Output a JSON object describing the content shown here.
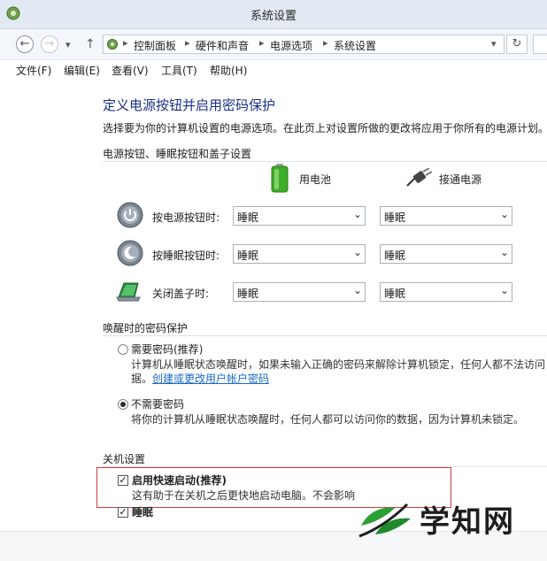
{
  "window": {
    "title": "系统设置"
  },
  "nav": {
    "breadcrumbs": [
      "控制面板",
      "硬件和声音",
      "电源选项",
      "系统设置"
    ]
  },
  "menu": [
    "文件(F)",
    "编辑(E)",
    "查看(V)",
    "工具(T)",
    "帮助(H)"
  ],
  "main": {
    "title": "定义电源按钮并启用密码保护",
    "description": "选择要为你的计算机设置的电源选项。在此页上对设置所做的更改将应用于你所有的电源计划。",
    "power_section": {
      "heading": "电源按钮、睡眠按钮和盖子设置",
      "columns": [
        "用电池",
        "接通电源"
      ],
      "rows": [
        {
          "label": "按电源按钮时:",
          "battery": "睡眠",
          "plugged": "睡眠",
          "icon": "power-button-icon"
        },
        {
          "label": "按睡眠按钮时:",
          "battery": "睡眠",
          "plugged": "睡眠",
          "icon": "sleep-button-icon"
        },
        {
          "label": "关闭盖子时:",
          "battery": "睡眠",
          "plugged": "睡眠",
          "icon": "laptop-lid-icon"
        }
      ]
    },
    "password_section": {
      "heading": "唤醒时的密码保护",
      "options": [
        {
          "label": "需要密码(推荐)",
          "desc_line1": "计算机从睡眠状态唤醒时，如果未输入正确的密码来解除计算机锁定，任何人都不法访问",
          "desc_line2": "据。",
          "link": "创建或更改用户帐户密码",
          "selected": false
        },
        {
          "label": "不需要密码",
          "desc_line1": "将你的计算机从睡眠状态唤醒时，任何人都可以访问你的数据，因为计算机未锁定。",
          "selected": true
        }
      ]
    },
    "shutdown_section": {
      "heading": "关机设置",
      "options": [
        {
          "label": "启用快速启动(推荐)",
          "desc": "这有助于在关机之后更快地启动电脑。不会影响",
          "checked": true
        },
        {
          "label": "睡眠",
          "checked": true
        }
      ]
    }
  },
  "watermark": {
    "text": "学知网"
  },
  "colors": {
    "title_blue": "#1e3287",
    "link_blue": "#1a6bc4",
    "highlight_red": "#d33b3b",
    "battery_green": "#3fae2a"
  }
}
